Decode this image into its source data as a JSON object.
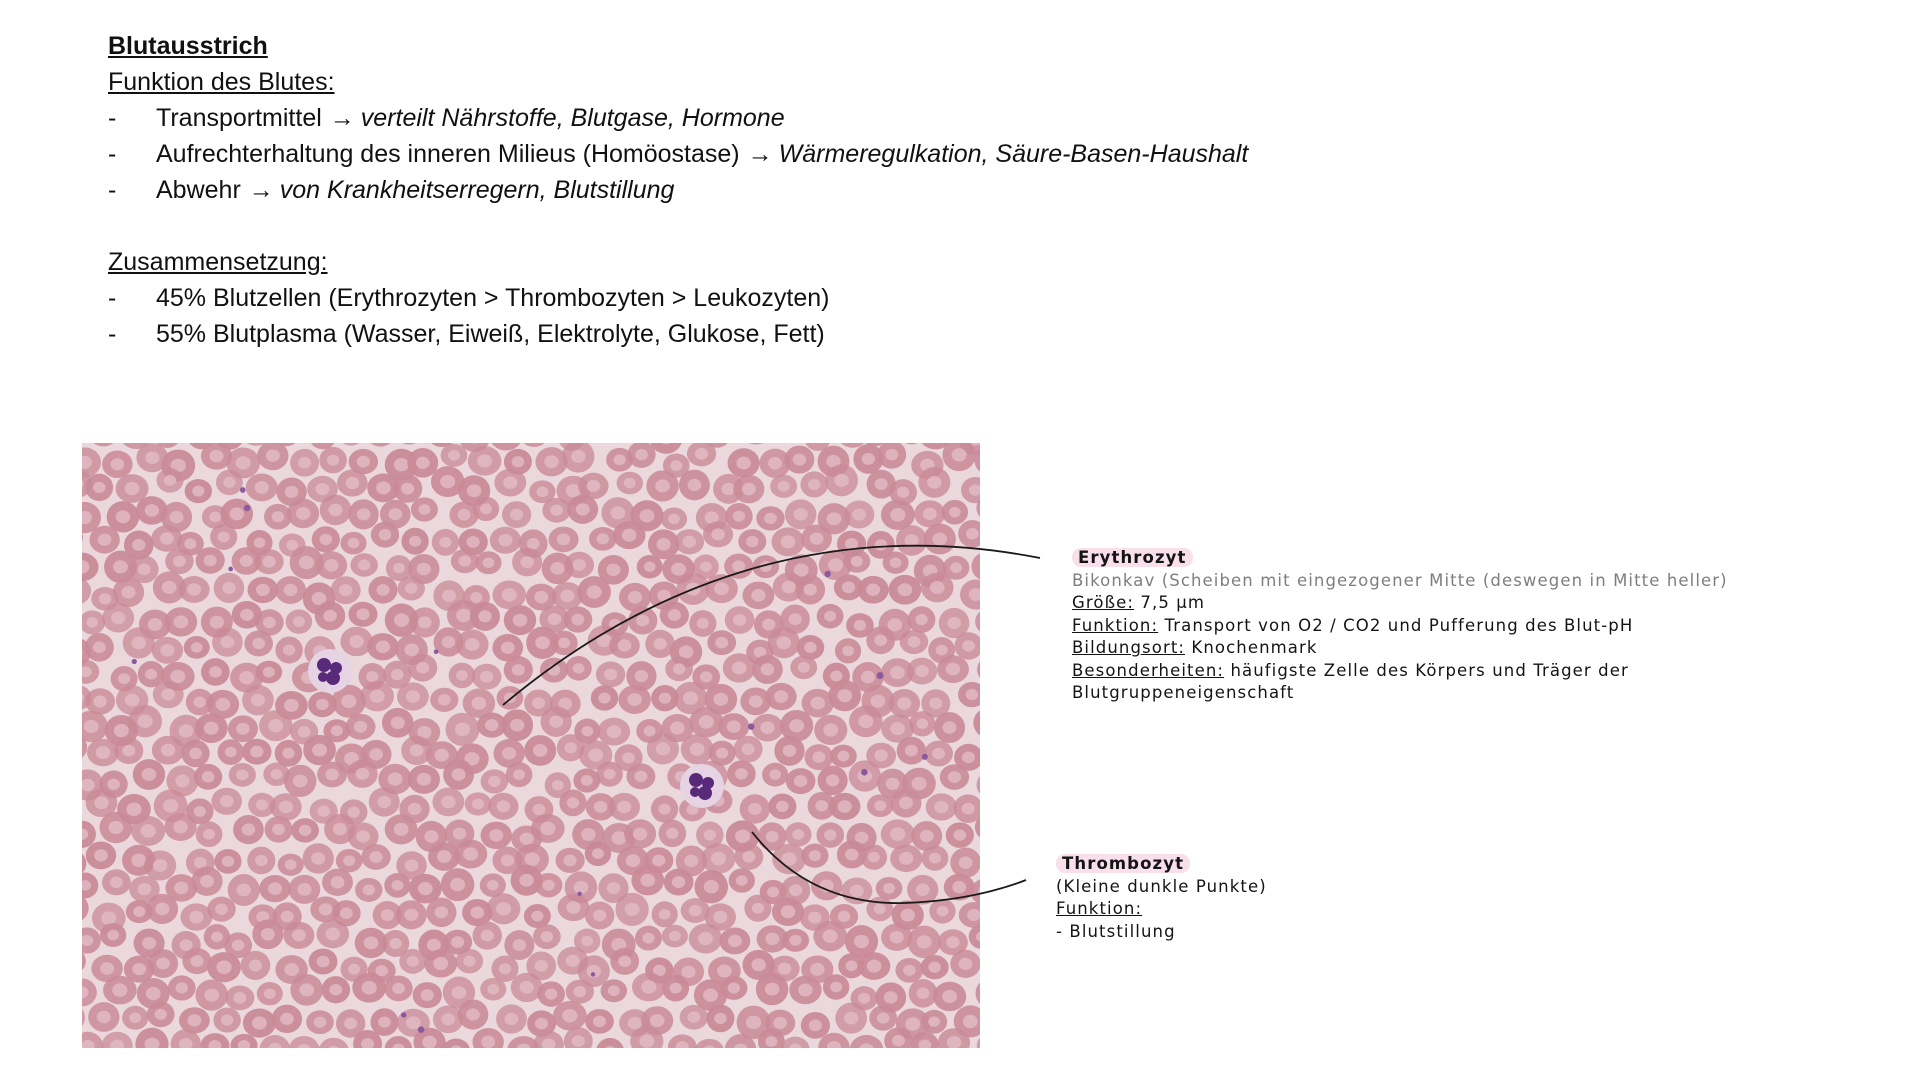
{
  "document": {
    "title": "Blutausstrich",
    "function_heading": "Funktion des Blutes:",
    "functions": [
      {
        "dash": "-",
        "term": "Transportmittel",
        "arrow": "→",
        "detail": "verteilt Nährstoffe, Blutgase, Hormone"
      },
      {
        "dash": "-",
        "term": "Aufrechterhaltung des inneren Milieus (Homöostase)",
        "arrow": "→",
        "detail": "Wärmeregulkation, Säure-Basen-Haushalt"
      },
      {
        "dash": "-",
        "term": "Abwehr",
        "arrow": "→",
        "detail": "von Krankheitserregern, Blutstillung"
      }
    ],
    "composition_heading": "Zusammensetzung:",
    "composition": [
      {
        "dash": "-",
        "text": "45% Blutzellen (Erythrozyten > Thrombozyten > Leukozyten)"
      },
      {
        "dash": "-",
        "text": "55% Blutplasma (Wasser, Eiweiß, Elektrolyte, Glukose, Fett)"
      }
    ]
  },
  "annotations": {
    "erythrozyt": {
      "name": "Erythrozyt",
      "shape": "Bikonkav (Scheiben mit eingezogener Mitte (deswegen in Mitte heller)",
      "size_label": "Größe:",
      "size_value": "7,5 µm",
      "function_label": "Funktion:",
      "function_value": "Transport von O2 / CO2 und Pufferung des Blut-pH",
      "origin_label": "Bildungsort:",
      "origin_value": "Knochenmark",
      "special_label": "Besonderheiten:",
      "special_value": "häufigste Zelle des Körpers und Träger der",
      "special_value_2": "Blutgruppeneigenschaft"
    },
    "thrombozyt": {
      "name": "Thrombozyt",
      "note": "(Kleine dunkle Punkte)",
      "function_label": "Funktion:",
      "function_value": "- Blutstillung"
    }
  },
  "colors": {
    "smear_background": "#ead8dd",
    "erythrocyte_rim": "#c98a97",
    "erythrocyte_center": "#e2bcc5",
    "leukocyte_nucleus": "#5a2a7a",
    "platelet": "#8a5a9e",
    "highlight": "#f8dfe9",
    "leader_line": "#1a1a1a"
  }
}
